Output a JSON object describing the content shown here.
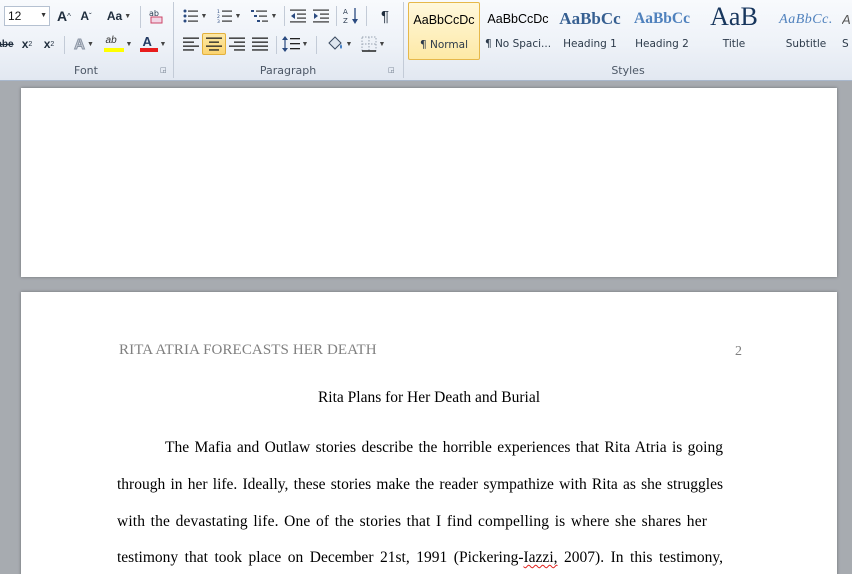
{
  "ribbon": {
    "font_group": {
      "label": "Font",
      "font_size": "12",
      "grow_font": "A",
      "shrink_font": "A",
      "change_case": "Aa",
      "strike": "abe",
      "subscript": "x",
      "superscript": "x",
      "text_effects": "A",
      "highlight": "ab",
      "font_color": "A"
    },
    "paragraph_group": {
      "label": "Paragraph",
      "show_marks": "¶"
    },
    "styles_group": {
      "label": "Styles",
      "items": [
        {
          "sample": "AaBbCcDc",
          "name": "¶ Normal"
        },
        {
          "sample": "AaBbCcDc",
          "name": "¶ No Spaci..."
        },
        {
          "sample": "AaBbCc",
          "name": "Heading 1"
        },
        {
          "sample": "AaBbCc",
          "name": "Heading 2"
        },
        {
          "sample": "AaB",
          "name": "Title"
        },
        {
          "sample": "AaBbCc.",
          "name": "Subtitle"
        },
        {
          "sample": "A",
          "name": "S"
        }
      ]
    }
  },
  "document": {
    "header": "RITA ATRIA FORECASTS HER DEATH",
    "page_number": "2",
    "title": "Rita Plans for Her Death and Burial",
    "lines": [
      "The Mafia and Outlaw stories describe the horrible experiences that Rita Atria is going",
      "through in her life. Ideally, these stories make the reader sympathize with Rita as she struggles",
      "with the devastating life. One of the stories that I find compelling is where she shares her"
    ],
    "last_line_before": "testimony that took place on December 21st, 1991 (Pickering-",
    "last_line_misspelled": "Iazzi,",
    "last_line_after": " 2007). In this testimony,"
  },
  "colors": {
    "highlight_yellow": "#ffff00",
    "font_red": "#e81c1c",
    "heading_blue": "#365f91",
    "title_navy": "#17365d",
    "subtitle_blue": "#4f81bd"
  }
}
